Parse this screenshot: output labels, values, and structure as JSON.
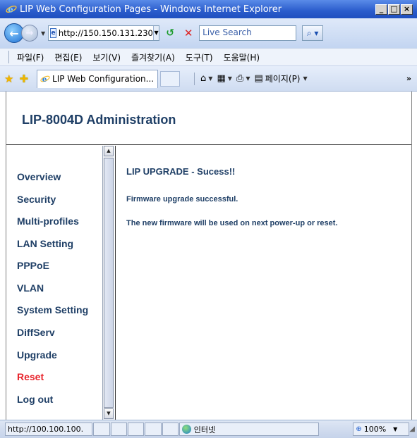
{
  "window": {
    "title": "LIP Web Configuration Pages - Windows Internet Explorer",
    "buttons": [
      "_",
      "□",
      "×"
    ]
  },
  "addressbar": {
    "url": "http://150.150.131.230",
    "search_placeholder": "Live Search"
  },
  "menu": {
    "items": [
      "파일(F)",
      "편집(E)",
      "보기(V)",
      "즐겨찾기(A)",
      "도구(T)",
      "도움말(H)"
    ]
  },
  "tabbar": {
    "tab_label": "LIP Web Configuration...",
    "page_menu": "페이지(P)"
  },
  "page": {
    "title": "LIP-8004D Administration",
    "nav": [
      {
        "label": "Overview",
        "active": false
      },
      {
        "label": "Security",
        "active": false
      },
      {
        "label": "Multi-profiles",
        "active": false
      },
      {
        "label": "LAN Setting",
        "active": false
      },
      {
        "label": "PPPoE",
        "active": false
      },
      {
        "label": "VLAN",
        "active": false
      },
      {
        "label": "System Setting",
        "active": false
      },
      {
        "label": "DiffServ",
        "active": false
      },
      {
        "label": "Upgrade",
        "active": false
      },
      {
        "label": "Reset",
        "active": true
      },
      {
        "label": "Log out",
        "active": false
      }
    ],
    "heading": "LIP UPGRADE - Sucess!!",
    "message_1": "Firmware upgrade successful.",
    "message_2": "The new firmware will be used on next power-up or reset."
  },
  "status": {
    "url": "http://100.100.100.",
    "zone": "인터넷",
    "zoom": "100%"
  },
  "colors": {
    "nav_text": "#1f3f66",
    "nav_active": "#e8242c"
  }
}
